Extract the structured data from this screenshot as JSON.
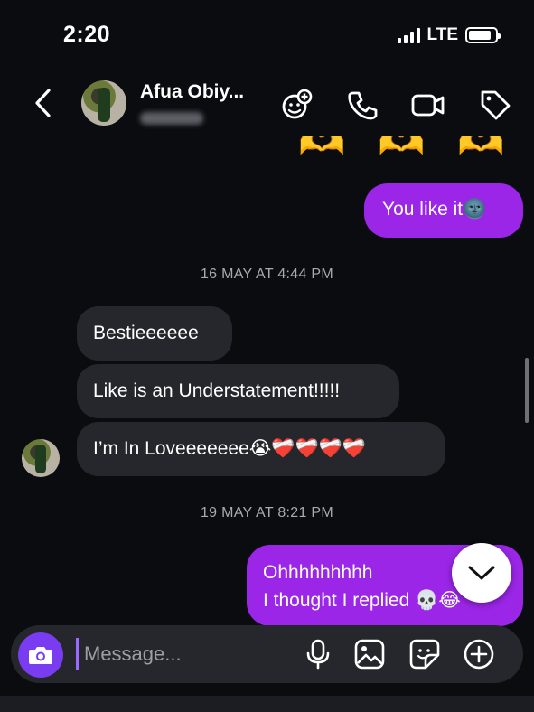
{
  "status": {
    "time": "2:20",
    "network": "LTE",
    "battery_level": 0.85
  },
  "header": {
    "contact_name": "Afua Obiy...",
    "contact_handle": "ms_ab"
  },
  "messages": {
    "top_emojis": [
      "🫶",
      "🫶",
      "🫶"
    ],
    "sent_1": "You like it🌚",
    "timestamp_1": "16 MAY AT 4:44 PM",
    "recv_1": "Bestieeeeee",
    "recv_2": "Like is an Understatement!!!!!",
    "recv_3": "I’m In Loveeeeeee😭❤️‍🩹❤️‍🩹❤️‍🩹❤️‍🩹",
    "timestamp_2": "19 MAY AT 8:21 PM",
    "sent_2_line1": "Ohhhhhhhhh",
    "sent_2_line2": "I thought I replied 💀😂"
  },
  "composer": {
    "placeholder": "Message..."
  },
  "colors": {
    "sent_bubble": "#9b26e8",
    "received_bubble": "#26272c",
    "background": "#0b0c10",
    "accent": "#7a3cf0"
  },
  "icons": [
    "back-icon",
    "add-people-icon",
    "phone-icon",
    "video-icon",
    "tag-icon",
    "camera-icon",
    "microphone-icon",
    "gallery-icon",
    "sticker-icon",
    "plus-icon",
    "chevron-down-icon"
  ]
}
